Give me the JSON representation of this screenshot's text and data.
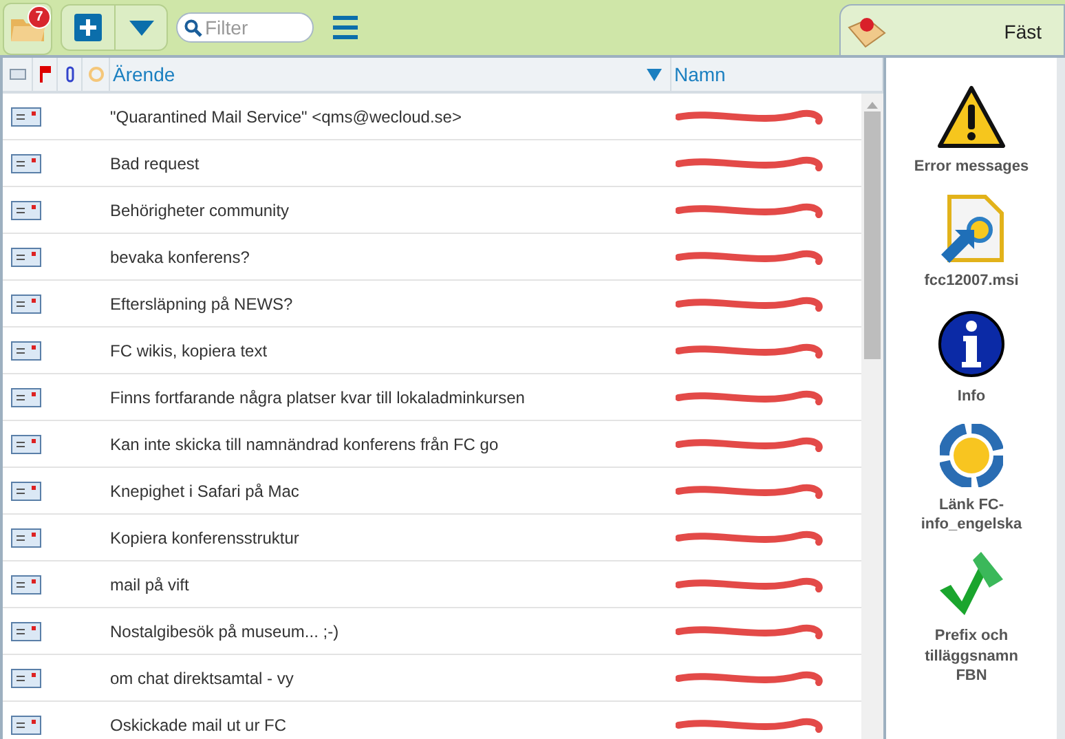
{
  "toolbar": {
    "unread_count": "7",
    "filter": {
      "placeholder": "Filter"
    },
    "pinned_tab": {
      "label": "Fäst"
    }
  },
  "table": {
    "columns": [
      {
        "label": "Ärende",
        "sorted": true
      },
      {
        "label": "Namn",
        "sorted": false
      }
    ],
    "rows": [
      {
        "subject": "\"Quarantined Mail Service\" <qms@wecloud.se>"
      },
      {
        "subject": "Bad request"
      },
      {
        "subject": "Behörigheter community"
      },
      {
        "subject": "bevaka konferens?"
      },
      {
        "subject": "Eftersläpning på NEWS?"
      },
      {
        "subject": "FC wikis, kopiera text"
      },
      {
        "subject": "Finns fortfarande några platser kvar till lokaladminkursen"
      },
      {
        "subject": "Kan inte skicka till namnändrad konferens från FC go"
      },
      {
        "subject": "Knepighet i Safari på Mac"
      },
      {
        "subject": "Kopiera konferensstruktur"
      },
      {
        "subject": "mail på vift"
      },
      {
        "subject": "Nostalgibesök på museum... ;-)"
      },
      {
        "subject": "om chat direktsamtal - vy"
      },
      {
        "subject": "Oskickade mail ut ur FC"
      }
    ]
  },
  "pinned": [
    {
      "kind": "warning",
      "label": "Error messages"
    },
    {
      "kind": "installer",
      "label": "fcc12007.msi"
    },
    {
      "kind": "info",
      "label": "Info"
    },
    {
      "kind": "link",
      "label": "Länk FC-info_engelska"
    },
    {
      "kind": "check",
      "label": "Prefix och tilläggsnamn FBN"
    }
  ]
}
